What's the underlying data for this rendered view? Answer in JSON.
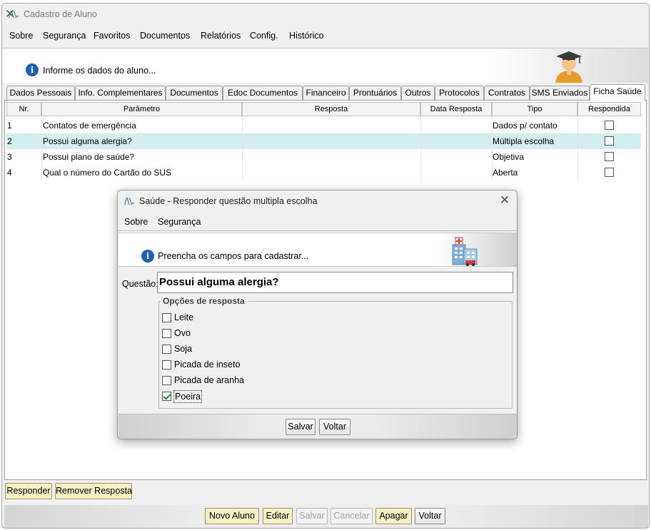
{
  "main_window": {
    "title": "Cadastro de Aluno",
    "menu": [
      "Sobre",
      "Segurança",
      "Favoritos",
      "Documentos",
      "Relatórios",
      "Config.",
      "Histórico"
    ],
    "info_text": "Informe os dados do aluno...",
    "tabs": [
      "Dados Pessoais",
      "Info. Complementares",
      "Documentos",
      "Edoc Documentos",
      "Financeiro",
      "Prontuários",
      "Outros",
      "Protocolos",
      "Contratos",
      "SMS Enviados",
      "Ficha Saúde"
    ],
    "active_tab": "Ficha Saúde",
    "grid": {
      "columns": [
        "Nr.",
        "Parâmetro",
        "Resposta",
        "Data Resposta",
        "Tipo",
        "Respondida"
      ],
      "rows": [
        {
          "nr": "1",
          "parametro": "Contatos de emergência",
          "resposta": "",
          "data": "",
          "tipo": "Dados p/ contato",
          "respondida": false
        },
        {
          "nr": "2",
          "parametro": "Possui alguma alergia?",
          "resposta": "",
          "data": "",
          "tipo": "Múltipla escolha",
          "respondida": false
        },
        {
          "nr": "3",
          "parametro": "Possui plano de saúde?",
          "resposta": "",
          "data": "",
          "tipo": "Objetiva",
          "respondida": false
        },
        {
          "nr": "4",
          "parametro": "Qual o número do Cartão do SUS",
          "resposta": "",
          "data": "",
          "tipo": "Aberta",
          "respondida": false
        }
      ],
      "selected_row": 1
    },
    "left_buttons": {
      "responder": "Responder",
      "remover": "Remover Resposta"
    },
    "bottom_buttons": {
      "novo": "Novo Aluno",
      "editar": "Editar",
      "salvar": "Salvar",
      "cancelar": "Cancelar",
      "apagar": "Apagar",
      "voltar": "Voltar"
    }
  },
  "dialog": {
    "title": "Saúde - Responder questão multipla escolha",
    "menu": [
      "Sobre",
      "Segurança"
    ],
    "info_text": "Preencha os campos para cadastrar...",
    "question_label": "Questão:",
    "question_value": "Possui alguma alergia?",
    "options_legend": "Opções de resposta",
    "options": [
      {
        "label": "Leite",
        "checked": false
      },
      {
        "label": "Ovo",
        "checked": false
      },
      {
        "label": "Soja",
        "checked": false
      },
      {
        "label": "Picada de inseto",
        "checked": false
      },
      {
        "label": "Picada de aranha",
        "checked": false
      },
      {
        "label": "Poeira",
        "checked": true
      }
    ],
    "buttons": {
      "salvar": "Salvar",
      "voltar": "Voltar"
    }
  },
  "icons": {
    "app_logo": "app-logo-icon",
    "close": "close-icon",
    "info": "info-icon",
    "student_avatar": "graduate-avatar-icon",
    "health": "hospital-icon"
  },
  "colors": {
    "selected_row": "#d3eeee",
    "yellow_button": "#f5efc3",
    "info_icon": "#1e5fb4",
    "check": "#1f8a1f"
  }
}
